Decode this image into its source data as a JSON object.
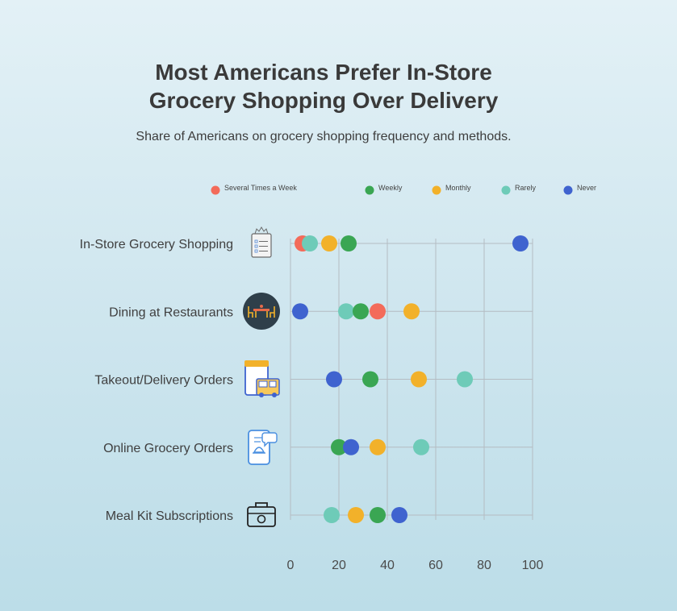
{
  "chart_data": {
    "type": "scatter",
    "title_lines": [
      "Most Americans Prefer In-Store",
      "Grocery Shopping Over Delivery"
    ],
    "subtitle": "Share of Americans on grocery shopping frequency and methods.",
    "xlim": [
      0,
      100
    ],
    "xticks": [
      0,
      20,
      40,
      60,
      80,
      100
    ],
    "grid": true,
    "legend_position": "top",
    "categories": [
      "In-Store Grocery Shopping",
      "Dining at Restaurants",
      "Takeout/Delivery Orders",
      "Online Grocery Orders",
      "Meal Kit Subscriptions"
    ],
    "category_icons": [
      "grocery-list-icon",
      "dining-table-icon",
      "food-truck-icon",
      "mobile-order-icon",
      "meal-kit-box-icon"
    ],
    "series": [
      {
        "name": "Several Times a Week",
        "color": "#f36b5a",
        "values": [
          5,
          36,
          null,
          null,
          null
        ]
      },
      {
        "name": "Weekly",
        "color": "#3aa653",
        "values": [
          24,
          29,
          33,
          20,
          36
        ]
      },
      {
        "name": "Monthly",
        "color": "#f2b12a",
        "values": [
          16,
          50,
          53,
          36,
          27
        ]
      },
      {
        "name": "Rarely",
        "color": "#6ecbb8",
        "values": [
          8,
          23,
          72,
          54,
          17
        ]
      },
      {
        "name": "Never",
        "color": "#3f63cf",
        "values": [
          95,
          4,
          18,
          25,
          45
        ]
      }
    ],
    "draw_order": [
      "Several Times a Week",
      "Rarely",
      "Monthly",
      "Weekly",
      "Never"
    ]
  }
}
